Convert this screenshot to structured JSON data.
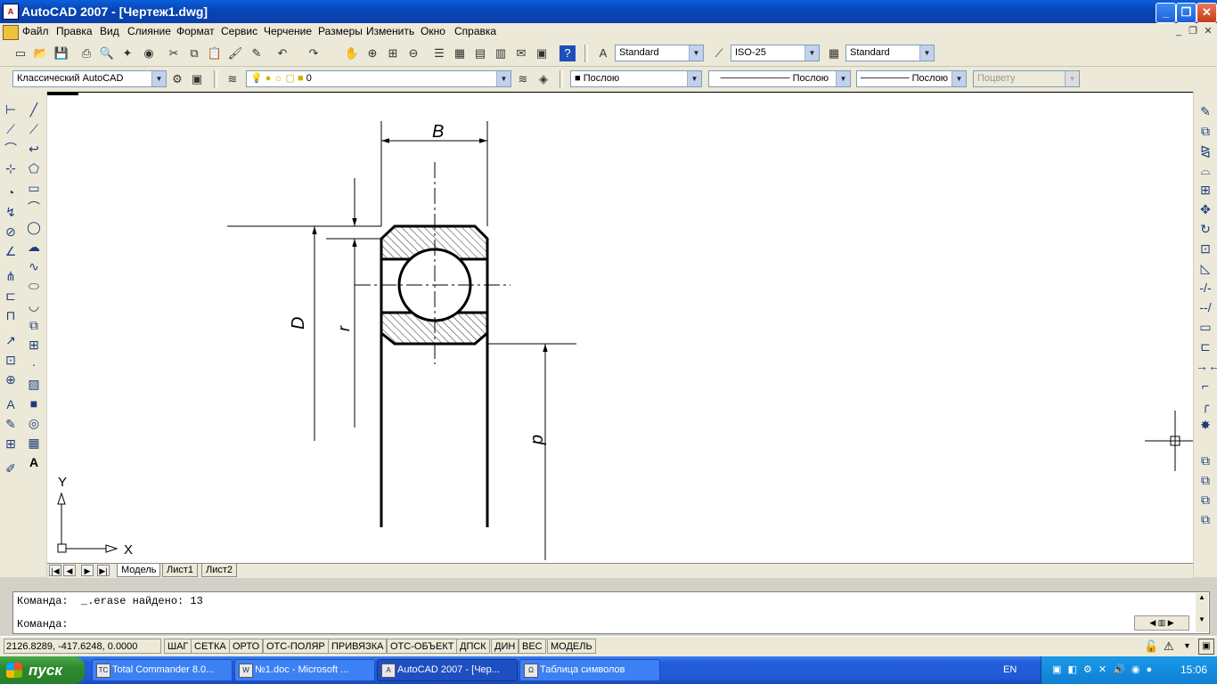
{
  "window": {
    "title": "AutoCAD 2007 - [Чертеж1.dwg]",
    "app_icon": "autocad-app-icon"
  },
  "menu": {
    "items": [
      "Файл",
      "Правка",
      "Вид",
      "Слияние",
      "Формат",
      "Сервис",
      "Черчение",
      "Размеры",
      "Изменить",
      "Окно",
      "Справка"
    ]
  },
  "toolbar1": {
    "text_style": "Standard",
    "dim_style": "ISO-25",
    "table_style": "Standard"
  },
  "toolbar2": {
    "workspace": "Классический AutoCAD",
    "layer": "0",
    "color": "Послою",
    "linetype": "Послою",
    "lineweight": "Послою",
    "plotstyle": "Поцвету"
  },
  "drawing": {
    "labels": {
      "width": "B",
      "outer_diameter": "D",
      "radius": "r",
      "inner_diameter": "d"
    },
    "ucs": {
      "x": "X",
      "y": "Y"
    }
  },
  "layout_tabs": [
    "Модель",
    "Лист1",
    "Лист2"
  ],
  "command": {
    "history": "Команда:  _.erase найдено: 13",
    "prompt": "Команда:"
  },
  "status": {
    "coordinates": "2126.8289, -417.6248, 0.0000",
    "toggles": [
      "ШАГ",
      "СЕТКА",
      "ОРТО",
      "ОТС-ПОЛЯР",
      "ПРИВЯЗКА",
      "ОТС-ОБЪЕКТ",
      "ДПСК",
      "ДИН",
      "ВЕС",
      "МОДЕЛЬ"
    ]
  },
  "taskbar": {
    "start": "пуск",
    "tasks": [
      "Total Commander 8.0...",
      "№1.doc - Microsoft ...",
      "AutoCAD 2007 - [Чер...",
      "Таблица символов"
    ],
    "language": "EN",
    "clock": "15:06"
  },
  "colors": {
    "taskbar": "#245edc",
    "start": "#2e8a2e",
    "titlebar": "#0a4fc8",
    "tray": "#0f7fd4"
  }
}
